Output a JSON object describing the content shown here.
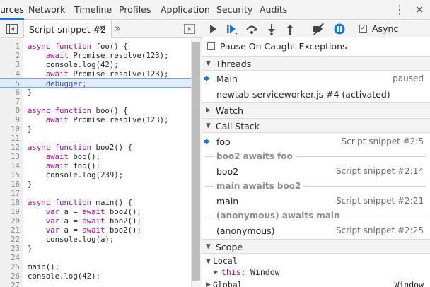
{
  "tabs": [
    {
      "label": "urces",
      "active": true
    },
    {
      "label": "Network"
    },
    {
      "label": "Timeline"
    },
    {
      "label": "Profiles"
    },
    {
      "label": "Application"
    },
    {
      "label": "Security"
    },
    {
      "label": "Audits"
    }
  ],
  "top_icons": {
    "more": "kebab-menu-icon",
    "close": "close-icon",
    "more_glyph": "⋮",
    "close_glyph": "✕"
  },
  "editor": {
    "file_tab_label": "Script snippet #2",
    "file_tab_close": "×",
    "more_tabs_glyph": "»",
    "paused_line": 5,
    "lines": [
      "async function foo() {",
      "    await Promise.resolve(123);",
      "    console.log(42);",
      "    await Promise.resolve(123);",
      "    debugger;",
      "}",
      "",
      "async function boo() {",
      "    await Promise.resolve(123);",
      "}",
      "",
      "async function boo2() {",
      "    await boo();",
      "    await foo();",
      "    console.log(239);",
      "}",
      "",
      "async function main() {",
      "    var a = await boo2();",
      "    var a = await boo2();",
      "    var a = await boo2();",
      "    console.log(a);",
      "}",
      "",
      "main();",
      "console.log(42);",
      ""
    ]
  },
  "debugger": {
    "toolbar": {
      "buttons": [
        "resume-icon",
        "step-over-async-icon",
        "step-over-icon",
        "step-into-icon",
        "step-out-icon",
        "deactivate-breakpoints-icon",
        "pause-on-exceptions-icon"
      ],
      "async_label": "Async",
      "async_checked": true,
      "check_glyph": "✓"
    },
    "pause_on_caught_label": "Pause On Caught Exceptions",
    "threads": {
      "title": "Threads",
      "items": [
        {
          "label": "Main",
          "status": "paused"
        },
        {
          "label": "newtab-serviceworker.js #4 (activated)",
          "status": ""
        }
      ]
    },
    "watch_title": "Watch",
    "call_stack": {
      "title": "Call Stack",
      "frames": [
        {
          "kind": "frame",
          "label": "foo",
          "loc": "Script snippet #2:5",
          "selected": true
        },
        {
          "kind": "async",
          "label": "boo2 awaits foo"
        },
        {
          "kind": "frame",
          "label": "boo2",
          "loc": "Script snippet #2:14"
        },
        {
          "kind": "async",
          "label": "main awaits boo2"
        },
        {
          "kind": "frame",
          "label": "main",
          "loc": "Script snippet #2:21"
        },
        {
          "kind": "async",
          "label": "(anonymous) awaits main"
        },
        {
          "kind": "frame",
          "label": "(anonymous)",
          "loc": "Script snippet #2:25"
        }
      ]
    },
    "scope": {
      "title": "Scope",
      "local_label": "Local",
      "this_key": "this:",
      "this_val": "Window",
      "global_label": "Global",
      "global_val": "Window"
    },
    "glyphs": {
      "expanded": "▼",
      "collapsed": "▶"
    }
  }
}
